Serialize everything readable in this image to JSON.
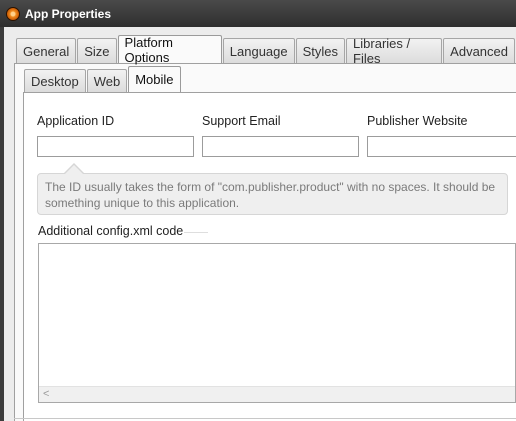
{
  "window": {
    "title": "App Properties"
  },
  "tabs": [
    {
      "label": "General"
    },
    {
      "label": "Size"
    },
    {
      "label": "Platform Options"
    },
    {
      "label": "Language"
    },
    {
      "label": "Styles"
    },
    {
      "label": "Libraries / Files"
    },
    {
      "label": "Advanced"
    }
  ],
  "active_tab": "Platform Options",
  "subtabs": [
    {
      "label": "Desktop"
    },
    {
      "label": "Web"
    },
    {
      "label": "Mobile"
    }
  ],
  "active_subtab": "Mobile",
  "fields": {
    "app_id": {
      "label": "Application ID",
      "value": ""
    },
    "support_email": {
      "label": "Support Email",
      "value": ""
    },
    "publisher_website": {
      "label": "Publisher Website",
      "value": ""
    }
  },
  "hint": "The ID usually takes the form of \"com.publisher.product\" with no spaces. It should be something unique to this application.",
  "config": {
    "label": "Additional config.xml code",
    "value": ""
  },
  "scroll_left_arrow": "<",
  "colors": {
    "titlebar": "#2e2e2e",
    "app_icon": "#f08a1c",
    "panel": "#ffffff"
  },
  "icons": {
    "app": "app-logo-icon",
    "scroll_left": "chevron-left-icon"
  }
}
